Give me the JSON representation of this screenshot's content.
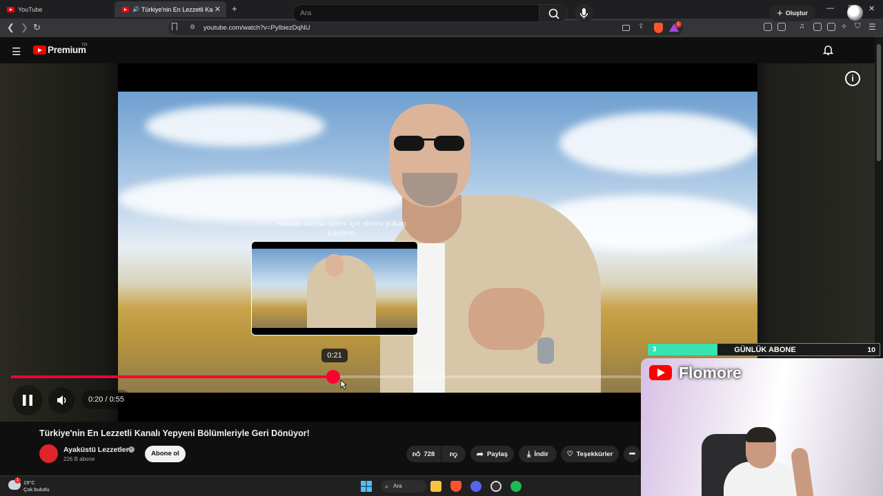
{
  "browser": {
    "tabs": [
      {
        "title": "YouTube",
        "active": false
      },
      {
        "title": "Türkiye'nin En Lezzetli Kanalı",
        "active": true,
        "audio": true
      }
    ],
    "new_tab_icon": "plus-icon",
    "url": "youtube.com/watch?v=PyIbiezDqNU",
    "brave_badge": "1"
  },
  "youtube": {
    "logo_text": "Premium",
    "country": "TR",
    "search_placeholder": "Ara",
    "create_label": "Oluştur"
  },
  "player": {
    "hint": "Hassas sarma işlemi için ekranı yukarı kaydırın",
    "hover_time": "0:21",
    "time_display": "0:20 / 0:55",
    "progress": 0.378,
    "state": "playing",
    "accent_color": "#ff0033"
  },
  "video": {
    "title": "Türkiye'nin En Lezzetli Kanalı Yepyeni Bölümleriyle Geri Dönüyor!",
    "channel": "Ayaküstü Lezzetler",
    "subscribers": "226 B abone",
    "subscribe_label": "Abone ol",
    "likes": "728",
    "share_label": "Paylaş",
    "download_label": "İndir",
    "thanks_label": "Teşekkürler"
  },
  "overlay": {
    "goal_current": "3",
    "goal_label": "GÜNLÜK ABONE",
    "goal_target": "10",
    "goal_fraction": 0.3,
    "streamer_name": "Flomore"
  },
  "taskbar": {
    "temperature": "19°C",
    "weather": "Çok bulutlu",
    "search_label": "Ara",
    "weather_badge": "1"
  }
}
